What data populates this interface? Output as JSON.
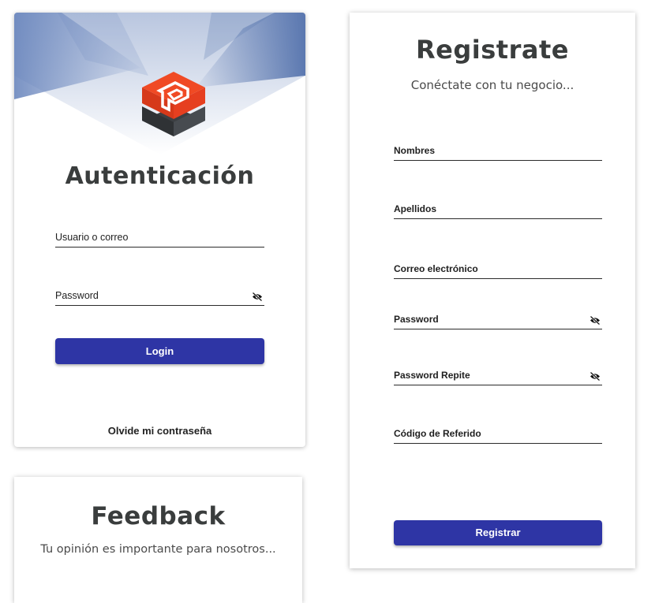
{
  "login": {
    "title": "Autenticación",
    "fields": [
      {
        "label": "Usuario o correo"
      },
      {
        "label": "Password",
        "icon": "visibility-off-icon"
      }
    ],
    "button_label": "Login",
    "forgot_label": "Olvide mi contraseña",
    "colors": {
      "banner": "#6a86bd",
      "logo_red": "#e63f20",
      "logo_dark": "#3c3f43",
      "button": "#2e35a5"
    }
  },
  "register": {
    "title": "Registrate",
    "subtitle": "Conéctate con tu negocio...",
    "fields": [
      {
        "label": "Nombres"
      },
      {
        "label": "Apellidos"
      },
      {
        "label": "Correo electrónico"
      },
      {
        "label": "Password",
        "icon": "visibility-off-icon"
      },
      {
        "label": "Password Repite",
        "icon": "visibility-off-icon"
      },
      {
        "label": "Código de Referido"
      }
    ],
    "button_label": "Registrar"
  },
  "feedback": {
    "title": "Feedback",
    "subtitle": "Tu opinión es importante para nosotros..."
  }
}
